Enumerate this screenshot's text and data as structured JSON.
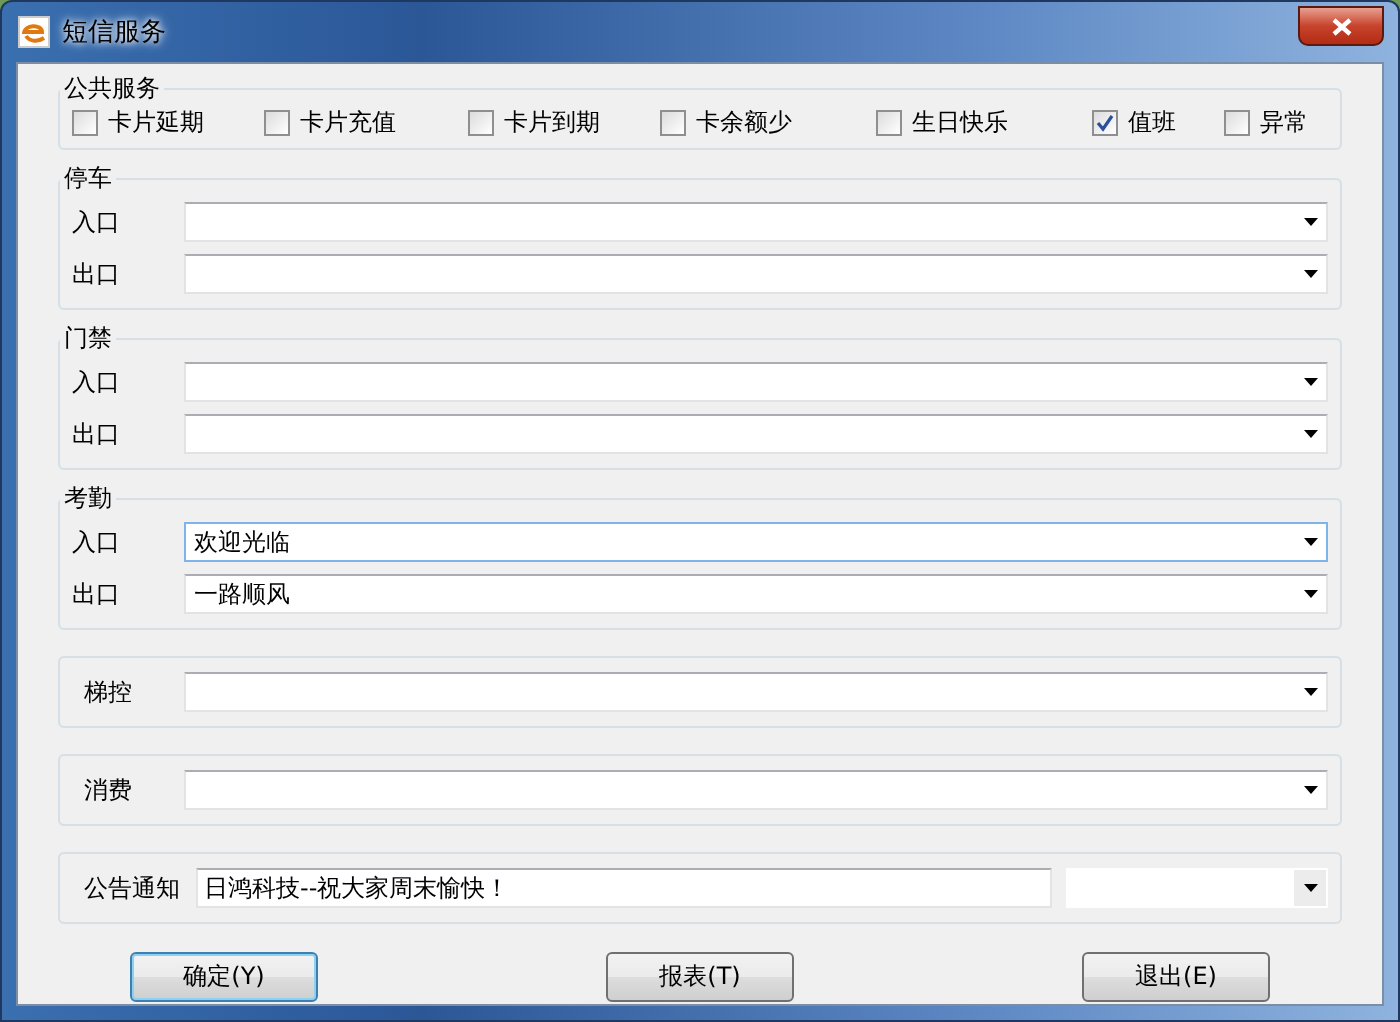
{
  "window": {
    "title": "短信服务"
  },
  "public_service": {
    "title": "公共服务",
    "options": [
      {
        "label": "卡片延期",
        "checked": false
      },
      {
        "label": "卡片充值",
        "checked": false
      },
      {
        "label": "卡片到期",
        "checked": false
      },
      {
        "label": "卡余额少",
        "checked": false
      },
      {
        "label": "生日快乐",
        "checked": false
      },
      {
        "label": "值班",
        "checked": true
      },
      {
        "label": "异常",
        "checked": false
      }
    ]
  },
  "groups": [
    {
      "title": "停车",
      "fields": [
        {
          "label": "入口",
          "focused": false
        },
        {
          "label": "出口",
          "focused": false
        }
      ]
    },
    {
      "title": "门禁",
      "fields": [
        {
          "label": "入口",
          "focused": false
        },
        {
          "label": "出口",
          "focused": false
        }
      ]
    },
    {
      "title": "考勤",
      "fields": [
        {
          "label": "入口",
          "value": "欢迎光临",
          "focused": true
        },
        {
          "label": "出口",
          "value": "一路顺风",
          "focused": false
        }
      ]
    }
  ],
  "single_rows": [
    {
      "label": "梯控"
    },
    {
      "label": "消费"
    }
  ],
  "notice": {
    "label": "公告通知",
    "value": "日鸿科技--祝大家周末愉快！"
  },
  "buttons": [
    {
      "label": "确定(Y)",
      "default": true
    },
    {
      "label": "报表(T)",
      "default": false
    },
    {
      "label": "退出(E)",
      "default": false
    }
  ]
}
